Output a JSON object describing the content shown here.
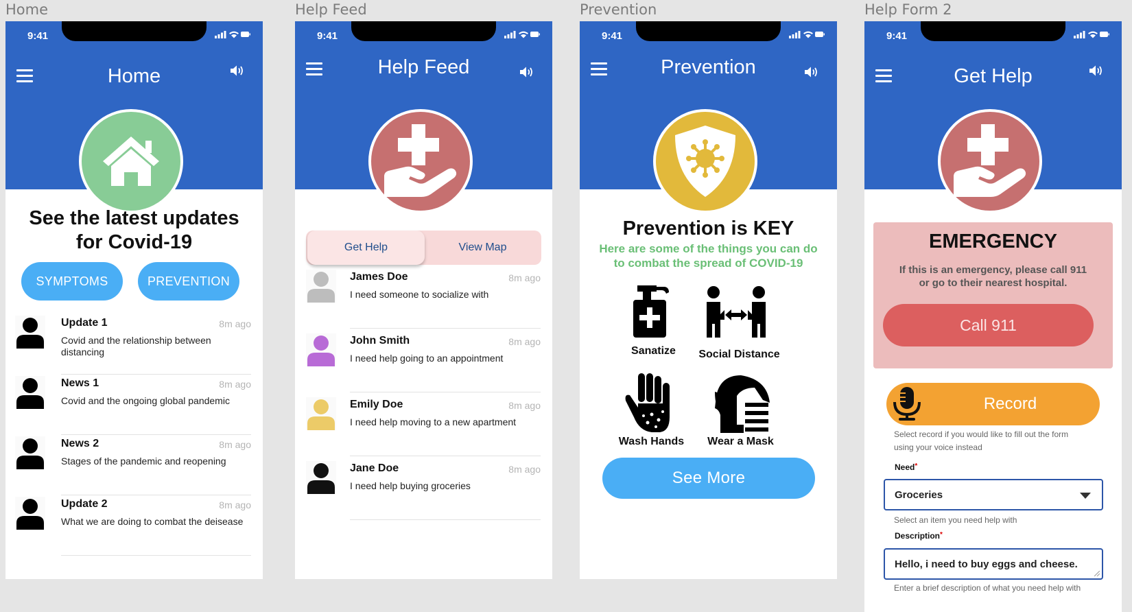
{
  "frames": [
    {
      "label": "Home"
    },
    {
      "label": "Help Feed"
    },
    {
      "label": "Prevention"
    },
    {
      "label": "Help Form 2"
    }
  ],
  "status_time": "9:41",
  "colors": {
    "header_blue": "#2f66c4",
    "home_green": "#88cc96",
    "help_red": "#c67070",
    "prevention_yellow": "#e2b93b",
    "pill_blue": "#4aaef5"
  },
  "home": {
    "title": "Home",
    "icon": "house-icon",
    "headline": "See the latest updates for Covid-19",
    "buttons": {
      "symptoms": "SYMPTOMS",
      "prevention": "PREVENTION"
    },
    "items": [
      {
        "title": "Update 1",
        "time": "8m ago",
        "text": "Covid and the relationship between distancing"
      },
      {
        "title": "News  1",
        "time": "8m ago",
        "text": "Covid and the ongoing global pandemic"
      },
      {
        "title": "News 2",
        "time": "8m ago",
        "text": "Stages of the pandemic and reopening"
      },
      {
        "title": "Update 2",
        "time": "8m ago",
        "text": "What we are doing to combat the deisease"
      }
    ]
  },
  "feed": {
    "title": "Help Feed",
    "icon": "helping-hand-cross-icon",
    "tabs": {
      "get_help": "Get Help",
      "view_map": "View Map"
    },
    "items": [
      {
        "name": "James  Doe",
        "time": "8m ago",
        "text": "I need someone to socialize with",
        "avatar_color": "#bdbdbd"
      },
      {
        "name": "John Smith",
        "time": "8m ago",
        "text": "I need help going to an appointment",
        "avatar_color": "#b86bd6"
      },
      {
        "name": "Emily Doe",
        "time": "8m ago",
        "text": "I need help moving to a new apartment",
        "avatar_color": "#eccb68"
      },
      {
        "name": "Jane Doe",
        "time": "8m ago",
        "text": "I need help buying groceries",
        "avatar_color": "#111111"
      }
    ]
  },
  "prevention": {
    "title": "Prevention",
    "icon": "virus-shield-icon",
    "headline": "Prevention is KEY",
    "subhead_line1": "Here are  some of the things you can do",
    "subhead_line2": "to combat the spread of COVID-19",
    "items": [
      {
        "label": "Sanatize",
        "icon": "sanitizer-icon"
      },
      {
        "label": "Social Distance",
        "icon": "social-distance-icon"
      },
      {
        "label": "Wash Hands",
        "icon": "wash-hands-icon"
      },
      {
        "label": "Wear a Mask",
        "icon": "mask-icon"
      }
    ],
    "see_more": "See More"
  },
  "help_form": {
    "title": "Get Help",
    "icon": "helping-hand-cross-icon",
    "emergency_title": "EMERGENCY",
    "emergency_line1": "If this is an emergency, please call 911",
    "emergency_line2": "or go to their nearest hospital.",
    "call_button": "Call 911",
    "record_button": "Record",
    "record_hint_line1": "Select record if you would like to fill out the form",
    "record_hint_line2": "using your voice instead",
    "need_label": "Need",
    "need_value": "Groceries",
    "need_hint": "Select an item you need help with",
    "description_label": "Description",
    "description_value": "Hello, i need to buy eggs and cheese.",
    "description_hint": "Enter a brief description of what you need help with"
  }
}
